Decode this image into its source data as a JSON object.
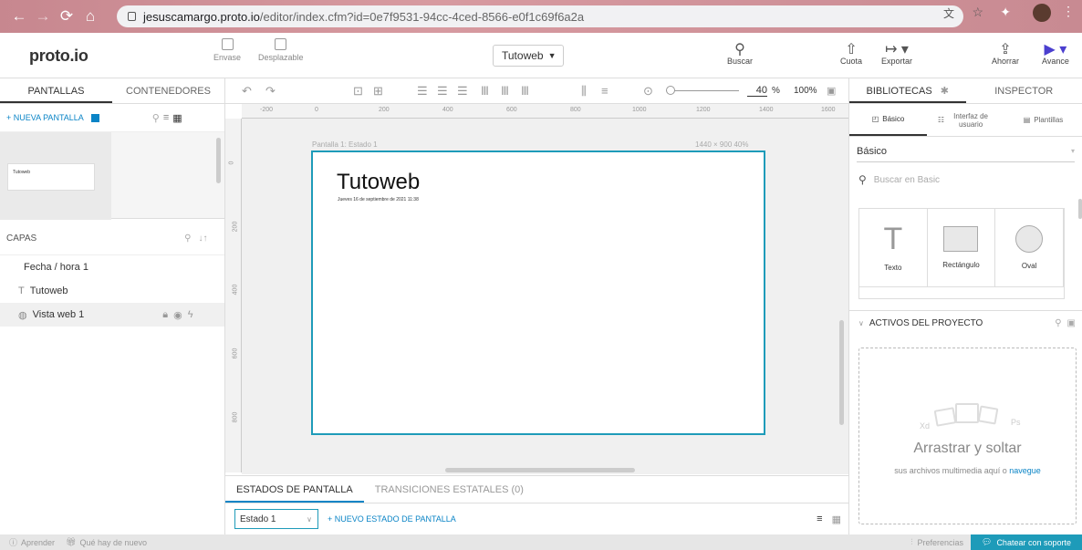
{
  "browser": {
    "url_domain": "jesuscamargo.proto.io",
    "url_path": "/editor/index.cfm?id=0e7f9531-94cc-4ced-8566-e0f1c69f6a2a"
  },
  "topbar": {
    "logo": "proto.io",
    "envase_label": "Envase",
    "desplazable_label": "Desplazable",
    "project_name": "Tutoweb",
    "buscar_label": "Buscar",
    "cuota_label": "Cuota",
    "exportar_label": "Exportar",
    "ahorrar_label": "Ahorrar",
    "avance_label": "Avance"
  },
  "left": {
    "tab_pantallas": "PANTALLAS",
    "tab_contenedores": "CONTENEDORES",
    "new_screen": "+ NUEVA PANTALLA",
    "thumb_text": "Tutoweb",
    "layers_title": "CAPAS",
    "layers": [
      {
        "icon": "",
        "label": "Fecha / hora 1"
      },
      {
        "icon": "T",
        "label": "Tutoweb"
      },
      {
        "icon": "◍",
        "label": "Vista web 1"
      }
    ]
  },
  "canvas": {
    "zoom_value": "40",
    "zoom_unit": "%",
    "zoom_100": "100%",
    "ruler_h": [
      "-200",
      "0",
      "200",
      "400",
      "600",
      "800",
      "1000",
      "1200",
      "1400",
      "1600"
    ],
    "ruler_v": [
      "0",
      "200",
      "400",
      "600",
      "800"
    ],
    "frame_label": "Pantalla 1: Estado 1",
    "frame_size": "1440 × 900   40%",
    "frame_title": "Tutoweb",
    "frame_date": "Jueves 16  de septiembre de 2021 11:38"
  },
  "states": {
    "tab_estados": "ESTADOS DE PANTALLA",
    "tab_transiciones": "TRANSICIONES ESTATALES (0)",
    "current_state": "Estado 1",
    "new_state": "+   NUEVO ESTADO DE PANTALLA"
  },
  "right": {
    "tab_bibliotecas": "BIBLIOTECAS",
    "tab_inspector": "INSPECTOR",
    "lib_basico": "Básico",
    "lib_interfaz": "Interfaz de usuario",
    "lib_plantillas": "Plantillas",
    "basic_select": "Básico",
    "search_placeholder": "Buscar en Basic",
    "items": [
      "Texto",
      "Rectángulo",
      "Oval"
    ],
    "assets_title": "ACTIVOS DEL PROYECTO",
    "drop_title": "Arrastrar y soltar",
    "drop_sub": "sus archivos multimedia aquí o",
    "drop_link": "navegue",
    "xd_label": "Xd",
    "ps_label": "Ps"
  },
  "footer": {
    "aprender": "Aprender",
    "que_hay": "Qué hay de nuevo",
    "preferencias": "Preferencias",
    "chat": "Chatear con soporte"
  }
}
